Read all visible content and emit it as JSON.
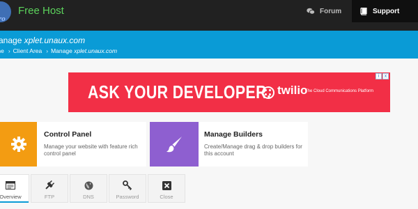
{
  "topbar": {
    "brand": "Free Host",
    "nav": [
      {
        "label": "Forum",
        "icon": "chat-bubbles-icon"
      },
      {
        "label": "Support",
        "icon": "book-icon"
      }
    ]
  },
  "header": {
    "title_prefix": "anage ",
    "title_domain": "xplet.unaux.com",
    "breadcrumb": [
      "me",
      "Client Area",
      "Manage ",
      "xplet.unaux.com"
    ]
  },
  "ad": {
    "headline": "ASK YOUR DEVELOPER.",
    "brand": "twilio",
    "tagline": "The Cloud Communications Platform",
    "color": "#f22f46",
    "choices": [
      "i",
      "x"
    ]
  },
  "cards": [
    {
      "title": "Control Panel",
      "description": "Manage your website with feature rich control panel",
      "icon": "gear-icon",
      "color": "#f39c12"
    },
    {
      "title": "Manage Builders",
      "description": "Create/Manage drag & drop builders for this account",
      "icon": "paintbrush-icon",
      "color": "#8e5fd0"
    }
  ],
  "tabs": [
    {
      "label": "Overview",
      "icon": "browser-window-icon",
      "active": true
    },
    {
      "label": "FTP",
      "icon": "plug-icon",
      "active": false
    },
    {
      "label": "DNS",
      "icon": "globe-icon",
      "active": false
    },
    {
      "label": "Password",
      "icon": "key-icon",
      "active": false
    },
    {
      "label": "Close",
      "icon": "close-box-icon",
      "active": false
    }
  ],
  "colors": {
    "topbar": "#212121",
    "header": "#0a9bd6",
    "brand": "#5cd35c"
  }
}
